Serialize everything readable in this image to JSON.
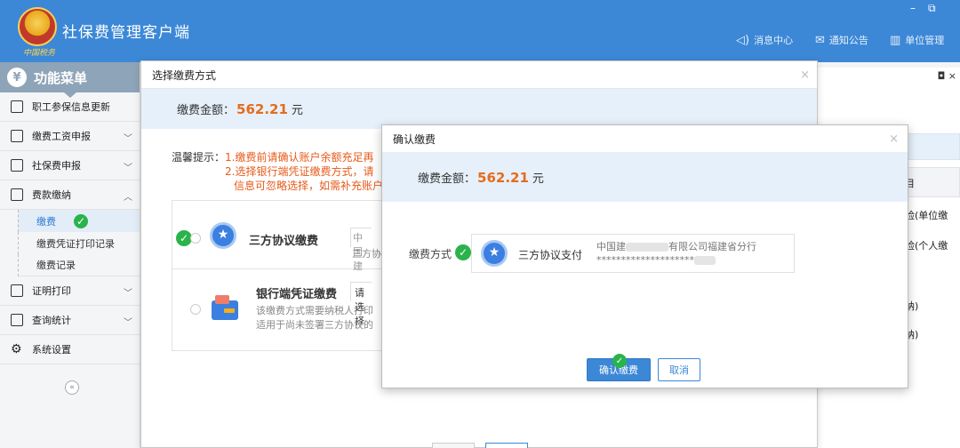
{
  "app": {
    "title": "社保费管理客户端",
    "logo_caption": "中国税务"
  },
  "window_controls": {
    "minimize": "–",
    "restore": "⧉"
  },
  "top_nav": [
    {
      "label": "消息中心",
      "icon": "speaker-icon"
    },
    {
      "label": "通知公告",
      "icon": "mail-icon"
    },
    {
      "label": "单位管理",
      "icon": "building-icon"
    }
  ],
  "sidebar": {
    "header": "功能菜单",
    "items": [
      {
        "label": "职工参保信息更新",
        "icon": "list-icon"
      },
      {
        "label": "缴费工资申报",
        "icon": "edit-icon"
      },
      {
        "label": "社保费申报",
        "icon": "document-icon"
      },
      {
        "label": "费款缴纳",
        "icon": "save-icon"
      },
      {
        "label": "证明打印",
        "icon": "print-icon"
      },
      {
        "label": "查询统计",
        "icon": "chart-icon"
      },
      {
        "label": "系统设置",
        "icon": "gear-icon"
      }
    ],
    "subitems": [
      {
        "label": "缴费",
        "active": true
      },
      {
        "label": "缴费凭证打印记录",
        "active": false
      },
      {
        "label": "缴费记录",
        "active": false
      }
    ],
    "collapse": "«"
  },
  "background_panel": {
    "controls": "◘ ×",
    "rows": [
      "目",
      "险(单位缴",
      "险(个人缴",
      "纳)",
      "纳)"
    ]
  },
  "select_dialog": {
    "title": "选择缴费方式",
    "close": "×",
    "amount_label": "缴费金额：",
    "amount_value": "562.21",
    "amount_unit": "元",
    "tips_label": "温馨提示：",
    "tips_lines": [
      "1.缴费前请确认账户余额充足再",
      "2.选择银行端凭证缴费方式，请",
      "信息可忽略选择，如需补充账户"
    ],
    "options": [
      {
        "name": "三方协议缴费",
        "input_line1": "中国建",
        "input_line2": "三方协"
      },
      {
        "name": "银行端凭证缴费",
        "select_text": "请选择",
        "desc_line1": "该缴费方式需要纳税人打印",
        "desc_line2": "适用于尚未签署三方协议的"
      }
    ]
  },
  "confirm_dialog": {
    "title": "确认缴费",
    "close": "×",
    "amount_label": "缴费金额：",
    "amount_value": "562.21",
    "amount_unit": "元",
    "method_label": "缴费方式",
    "method_name": "三方协议支付",
    "bank_line1_prefix": "中国建",
    "bank_line1_suffix": "有限公司福建省分行",
    "bank_line2": "********************",
    "ok_label": "确认缴费",
    "cancel_label": "取消"
  },
  "colors": {
    "primary": "#3c88d6",
    "amount": "#e66b1a",
    "tip": "#e65a1a",
    "check": "#2bb34b"
  }
}
